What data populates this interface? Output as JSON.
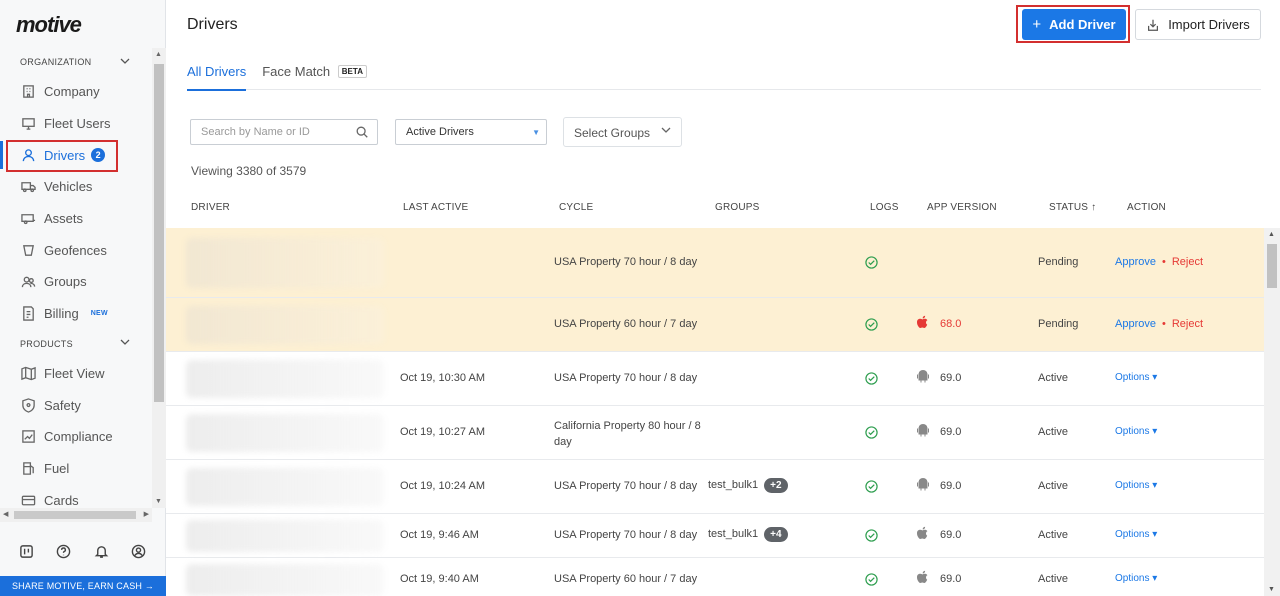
{
  "brand": {
    "logo_text": "motive"
  },
  "sidebar": {
    "org_section": "ORGANIZATION",
    "products_section": "PRODUCTS",
    "org_items": [
      {
        "label": "Company",
        "icon": "building-icon"
      },
      {
        "label": "Fleet Users",
        "icon": "monitor-icon"
      },
      {
        "label": "Drivers",
        "icon": "person-icon",
        "badge": "2",
        "active": true
      },
      {
        "label": "Vehicles",
        "icon": "truck-icon"
      },
      {
        "label": "Assets",
        "icon": "trailer-icon"
      },
      {
        "label": "Geofences",
        "icon": "geofence-icon"
      },
      {
        "label": "Groups",
        "icon": "groups-icon"
      },
      {
        "label": "Billing",
        "icon": "billing-icon",
        "tag": "NEW"
      }
    ],
    "product_items": [
      {
        "label": "Fleet View",
        "icon": "map-icon"
      },
      {
        "label": "Safety",
        "icon": "shield-icon"
      },
      {
        "label": "Compliance",
        "icon": "compliance-icon"
      },
      {
        "label": "Fuel",
        "icon": "fuel-icon"
      },
      {
        "label": "Cards",
        "icon": "card-icon"
      }
    ],
    "share_label": "SHARE MOTIVE, EARN CASH →"
  },
  "header": {
    "title": "Drivers",
    "add_driver_label": "Add Driver",
    "import_drivers_label": "Import Drivers"
  },
  "tabs": [
    {
      "label": "All Drivers",
      "active": true
    },
    {
      "label": "Face Match",
      "tag": "BETA"
    }
  ],
  "filters": {
    "search_placeholder": "Search by Name or ID",
    "driver_status_value": "Active Drivers",
    "groups_placeholder": "Select Groups"
  },
  "viewing_text": "Viewing 3380 of 3579",
  "table": {
    "columns": [
      "DRIVER",
      "LAST ACTIVE",
      "CYCLE",
      "GROUPS",
      "LOGS",
      "APP VERSION",
      "STATUS ↑",
      "ACTION"
    ],
    "rows": [
      {
        "last_active": "",
        "cycle": "USA Property 70 hour / 8 day",
        "groups": "",
        "groups_more": "",
        "os": "",
        "app_version": "",
        "status": "Pending",
        "action": "approve-reject"
      },
      {
        "last_active": "",
        "cycle": "USA Property 60 hour / 7 day",
        "groups": "",
        "groups_more": "",
        "os": "apple-icon",
        "app_version": "68.0",
        "status": "Pending",
        "action": "approve-reject"
      },
      {
        "last_active": "Oct 19, 10:30 AM",
        "cycle": "USA Property 70 hour / 8 day",
        "groups": "",
        "groups_more": "",
        "os": "android-icon",
        "app_version": "69.0",
        "status": "Active",
        "action": "options"
      },
      {
        "last_active": "Oct 19, 10:27 AM",
        "cycle": "California Property 80 hour / 8 day",
        "groups": "",
        "groups_more": "",
        "os": "android-icon",
        "app_version": "69.0",
        "status": "Active",
        "action": "options"
      },
      {
        "last_active": "Oct 19, 10:24 AM",
        "cycle": "USA Property 70 hour / 8 day",
        "groups": "test_bulk1",
        "groups_more": "+2",
        "os": "android-icon",
        "app_version": "69.0",
        "status": "Active",
        "action": "options"
      },
      {
        "last_active": "Oct 19, 9:46 AM",
        "cycle": "USA Property 70 hour / 8 day",
        "groups": "test_bulk1",
        "groups_more": "+4",
        "os": "apple-icon",
        "app_version": "69.0",
        "status": "Active",
        "action": "options"
      },
      {
        "last_active": "Oct 19, 9:40 AM",
        "cycle": "USA Property 60 hour / 7 day",
        "groups": "",
        "groups_more": "",
        "os": "apple-icon",
        "app_version": "69.0",
        "status": "Active",
        "action": "options"
      }
    ],
    "approve_label": "Approve",
    "reject_label": "Reject",
    "options_label": "Options ▾"
  }
}
